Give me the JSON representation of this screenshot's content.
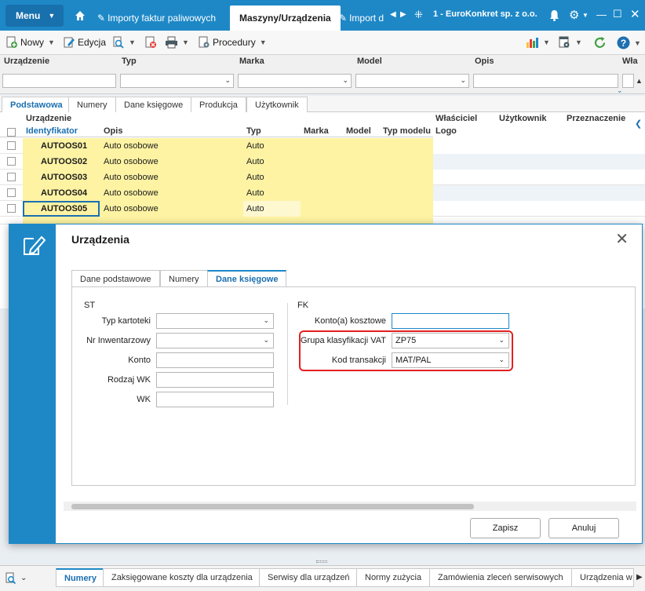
{
  "topbar": {
    "menu_label": "Menu",
    "tabs": [
      "Importy faktur paliwowych",
      "Maszyny/Urządzenia",
      "Import d"
    ],
    "company": "1 - EuroKonkret sp. z o.o."
  },
  "toolbar": {
    "new_label": "Nowy",
    "edit_label": "Edycja",
    "procedures_label": "Procedury"
  },
  "filters": [
    "Urządzenie",
    "Typ",
    "Marka",
    "Model",
    "Opis",
    "Wła"
  ],
  "grid_tabs": [
    "Podstawowa",
    "Numery",
    "Dane księgowe",
    "Produkcja",
    "Użytkownik"
  ],
  "grid": {
    "group_header": "Urządzenie",
    "columns": [
      "Identyfikator",
      "Opis",
      "Typ",
      "Marka",
      "Model",
      "Typ modelu",
      "Właściciel",
      "Logo",
      "Użytkownik",
      "Przeznaczenie"
    ],
    "rows": [
      {
        "id": "AUTOOS01",
        "opis": "Auto osobowe",
        "typ": "Auto"
      },
      {
        "id": "AUTOOS02",
        "opis": "Auto osobowe",
        "typ": "Auto"
      },
      {
        "id": "AUTOOS03",
        "opis": "Auto osobowe",
        "typ": "Auto"
      },
      {
        "id": "AUTOOS04",
        "opis": "Auto osobowe",
        "typ": "Auto"
      },
      {
        "id": "AUTOOS05",
        "opis": "Auto osobowe",
        "typ": "Auto"
      }
    ]
  },
  "dialog": {
    "title": "Urządzenia",
    "tabs": [
      "Dane podstawowe",
      "Numery",
      "Dane księgowe"
    ],
    "st_label": "ST",
    "fk_label": "FK",
    "st_fields": [
      {
        "label": "Typ kartoteki",
        "value": ""
      },
      {
        "label": "Nr Inwentarzowy",
        "value": ""
      },
      {
        "label": "Konto",
        "value": ""
      },
      {
        "label": "Rodzaj WK",
        "value": ""
      },
      {
        "label": "WK",
        "value": ""
      }
    ],
    "fk_fields": [
      {
        "label": "Konto(a) kosztowe",
        "value": ""
      },
      {
        "label": "Grupa klasyfikacji VAT",
        "value": "ZP75"
      },
      {
        "label": "Kod transakcji",
        "value": "MAT/PAL"
      }
    ],
    "save_label": "Zapisz",
    "cancel_label": "Anuluj"
  },
  "bottom_tabs": [
    "Numery",
    "Zaksięgowane koszty dla urządzenia",
    "Serwisy dla urządzeń",
    "Normy zużycia",
    "Zamówienia zleceń serwisowych",
    "Urządzenia w"
  ]
}
